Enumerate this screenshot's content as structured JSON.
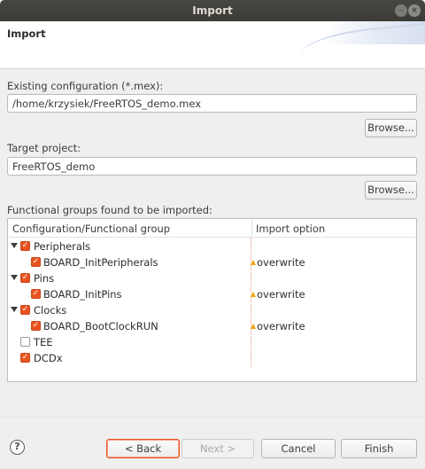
{
  "window": {
    "title": "Import"
  },
  "header": {
    "title": "Import"
  },
  "config": {
    "label": "Existing configuration (*.mex):",
    "value": "/home/krzysiek/FreeRTOS_demo.mex",
    "browse_label": "Browse..."
  },
  "project": {
    "label": "Target project:",
    "value": "FreeRTOS_demo",
    "browse_label": "Browse..."
  },
  "groups": {
    "label": "Functional groups found to be imported:",
    "columns": [
      "Configuration/Functional group",
      "Import option"
    ],
    "rows": [
      {
        "label": "Peripherals",
        "checked": true,
        "expanded": true,
        "option": ""
      },
      {
        "label": "BOARD_InitPeripherals",
        "checked": true,
        "option": "overwrite"
      },
      {
        "label": "Pins",
        "checked": true,
        "expanded": true,
        "option": ""
      },
      {
        "label": "BOARD_InitPins",
        "checked": true,
        "option": "overwrite"
      },
      {
        "label": "Clocks",
        "checked": true,
        "expanded": true,
        "option": ""
      },
      {
        "label": "BOARD_BootClockRUN",
        "checked": true,
        "option": "overwrite"
      },
      {
        "label": "TEE",
        "checked": false,
        "option": ""
      },
      {
        "label": "DCDx",
        "checked": true,
        "option": ""
      }
    ]
  },
  "footer": {
    "help_icon": "question-circle-icon",
    "back_label": "< Back",
    "next_label": "Next >",
    "cancel_label": "Cancel",
    "finish_label": "Finish"
  },
  "colors": {
    "accent": "#e95420",
    "warning": "#f0a30a",
    "titlebar": "#3c3b37"
  }
}
